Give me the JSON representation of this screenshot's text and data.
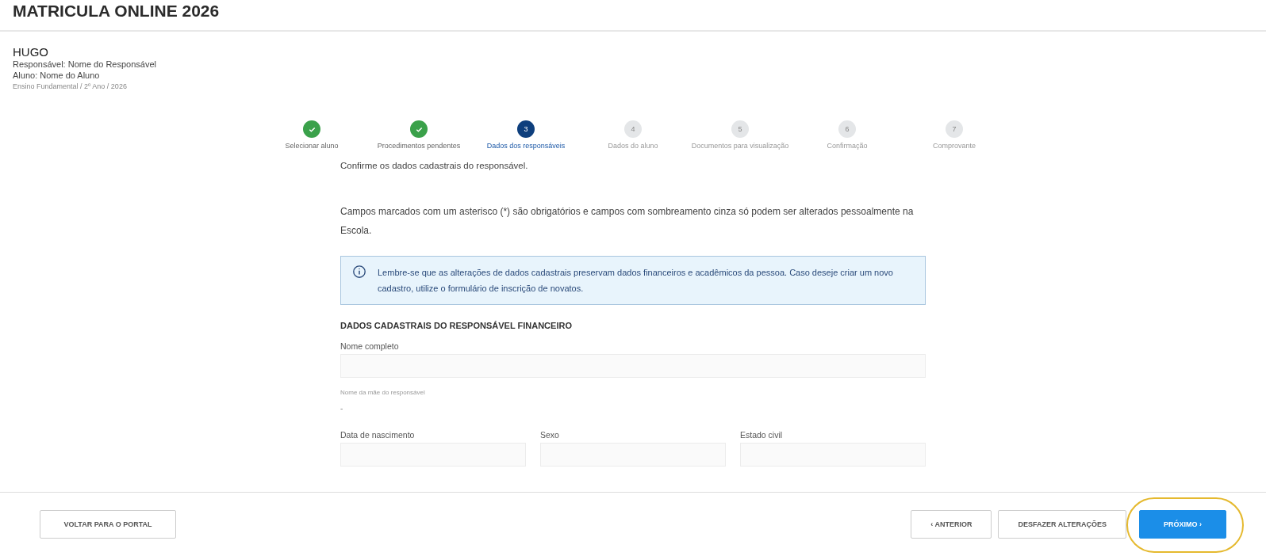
{
  "page": {
    "title": "MATRICULA ONLINE 2026"
  },
  "header": {
    "name": "HUGO",
    "responsible": "Responsável: Nome do Responsável",
    "student": "Aluno: Nome do Aluno",
    "course": "Ensino Fundamental / 2º Ano / 2026"
  },
  "steps": [
    {
      "label": "Selecionar aluno",
      "done": true,
      "selected": false
    },
    {
      "label": "Procedimentos pendentes",
      "done": true,
      "selected": false
    },
    {
      "number": "3",
      "label": "Dados dos responsáveis",
      "done": false,
      "selected": true
    },
    {
      "number": "4",
      "label": "Dados do aluno",
      "done": false,
      "selected": false
    },
    {
      "number": "5",
      "label": "Documentos para visualização",
      "done": false,
      "selected": false
    },
    {
      "number": "6",
      "label": "Confirmação",
      "done": false,
      "selected": false
    },
    {
      "number": "7",
      "label": "Comprovante",
      "done": false,
      "selected": false
    }
  ],
  "intro": "Confirme os dados cadastrais do responsável.",
  "notice": "Campos marcados com um asterisco (*) são obrigatórios e campos com sombreamento cinza só podem ser alterados pessoalmente na Escola.",
  "info_box": "Lembre-se que as alterações de dados cadastrais preservam dados financeiros e acadêmicos da pessoa. Caso deseje criar um novo cadastro, utilize o formulário de inscrição de novatos.",
  "section_title": "DADOS CADASTRAIS DO RESPONSÁVEL FINANCEIRO",
  "fields": [
    {
      "kind": "input",
      "label": "Nome completo"
    },
    {
      "kind": "readonly",
      "label": "Nome da mãe do responsável",
      "value": "-"
    }
  ],
  "field_row": [
    {
      "label": "Data de nascimento"
    },
    {
      "label": "Sexo"
    },
    {
      "label": "Estado civil"
    }
  ],
  "footer": {
    "back_portal": "VOLTAR PARA O PORTAL",
    "previous": "‹ ANTERIOR",
    "undo": "DESFAZER ALTERAÇÕES",
    "next": {
      "label": "PRÓXIMO ›",
      "highlighted": true
    }
  }
}
